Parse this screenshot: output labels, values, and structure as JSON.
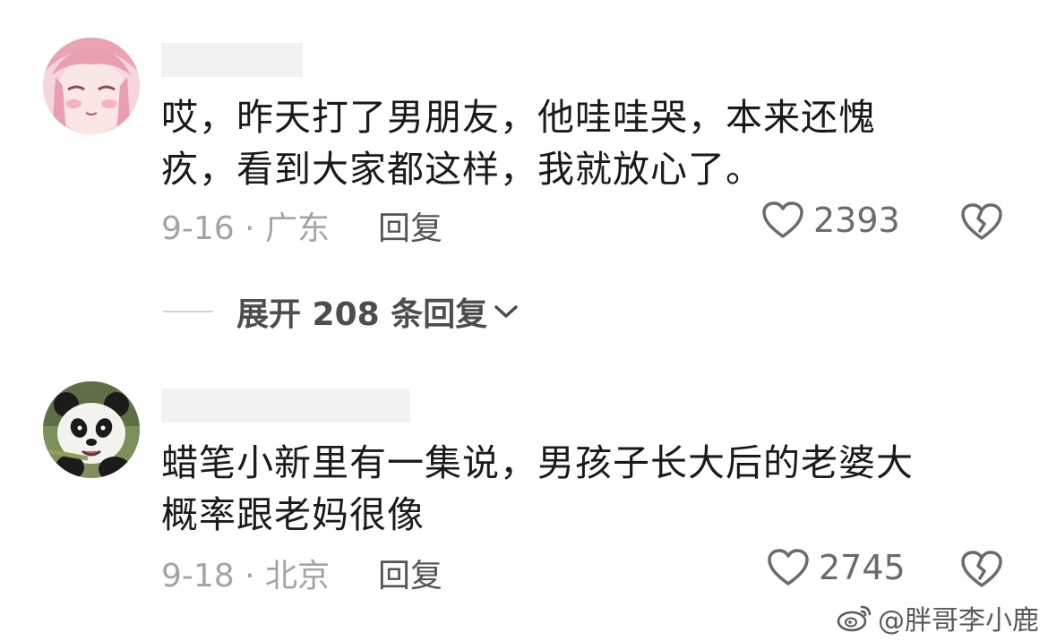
{
  "comments": [
    {
      "avatar": "anime-girl-avatar",
      "text_lines": [
        "哎，昨天打了男朋友，他哇哇哭，本来还愧",
        "疚，看到大家都这样，我就放心了。"
      ],
      "date_location": "9-16 · 广东",
      "reply_label": "回复",
      "likes": "2393"
    },
    {
      "avatar": "panda-avatar",
      "text_lines": [
        "蜡笔小新里有一集说，男孩子长大后的老婆大",
        "概率跟老妈很像"
      ],
      "date_location": "9-18 · 北京",
      "reply_label": "回复",
      "likes": "2745"
    }
  ],
  "expand_replies": {
    "label": "展开 208 条回复"
  },
  "icons": {
    "like": "heart-outline-icon",
    "dislike": "broken-heart-icon",
    "expand": "chevron-down-icon",
    "watermark": "weibo-logo-icon"
  },
  "watermark": {
    "text": "@胖哥李小鹿"
  },
  "colors": {
    "text": "#1a1a1a",
    "meta": "#a4a4a4",
    "icon": "#6b6b6b"
  }
}
